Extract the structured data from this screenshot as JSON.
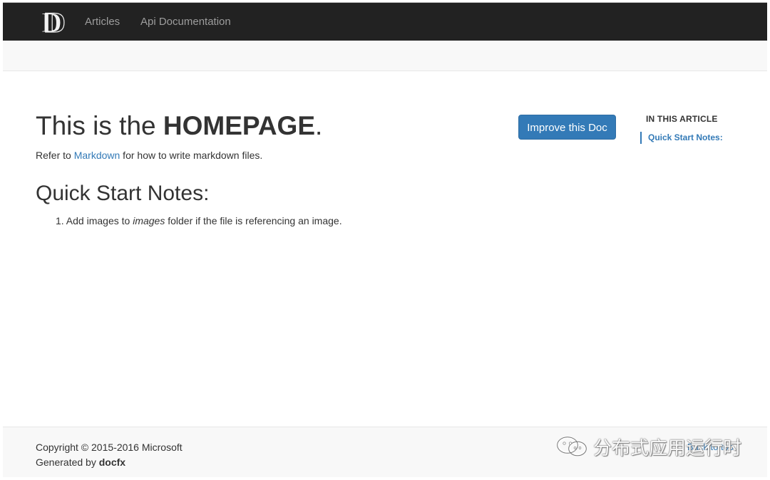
{
  "navbar": {
    "logo_letter": "D",
    "links": [
      {
        "label": "Articles"
      },
      {
        "label": "Api Documentation"
      }
    ]
  },
  "article": {
    "title_prefix": "This is the ",
    "title_emphasis": "HOMEPAGE",
    "title_suffix": ".",
    "intro_prefix": "Refer to ",
    "intro_link": "Markdown",
    "intro_suffix": " for how to write markdown files.",
    "section_title": "Quick Start Notes:",
    "notes": [
      {
        "number": "1.",
        "prefix": " Add images to ",
        "emphasis": "images",
        "suffix": " folder if the file is referencing an image."
      }
    ]
  },
  "actions": {
    "improve_doc_label": "Improve this Doc"
  },
  "affix": {
    "heading": "IN THIS ARTICLE",
    "links": [
      {
        "label": "Quick Start Notes:"
      }
    ]
  },
  "footer": {
    "copyright": "Copyright © 2015-2016 Microsoft",
    "generated_prefix": "Generated by ",
    "generated_tool": "docfx",
    "back_to_top": "Back to top"
  },
  "watermark": {
    "text": "分布式应用运行时"
  },
  "colors": {
    "navbar_bg": "#222222",
    "nav_link": "#9d9d9d",
    "accent": "#337ab7",
    "subnav_bg": "#f8f8f8",
    "footer_bg": "#f8f8f8",
    "text": "#333333"
  },
  "icons": {
    "logo": "docfx-logo-icon",
    "watermark": "wechat-icon"
  }
}
